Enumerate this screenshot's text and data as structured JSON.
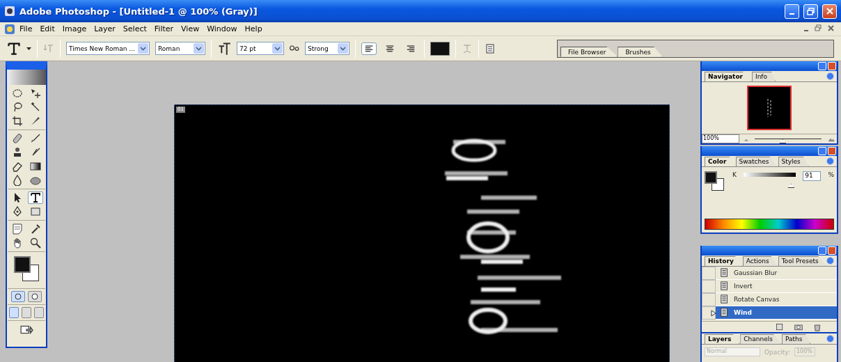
{
  "window": {
    "title": "Adobe Photoshop - [Untitled-1 @ 100% (Gray)]"
  },
  "menu": [
    "File",
    "Edit",
    "Image",
    "Layer",
    "Select",
    "Filter",
    "View",
    "Window",
    "Help"
  ],
  "options_bar": {
    "font_family": "Times New Roman ...",
    "font_style": "Roman",
    "font_size": "72 pt",
    "anti_alias": "Strong",
    "align": [
      {
        "kind": "left",
        "selected": true
      },
      {
        "kind": "center",
        "selected": false
      },
      {
        "kind": "right",
        "selected": false
      }
    ]
  },
  "palette_well": {
    "tabs": [
      {
        "label": "File Browser"
      },
      {
        "label": "Brushes"
      }
    ]
  },
  "toolbox": {
    "groups": [
      [
        {
          "kind": "marquee",
          "selected": false
        },
        {
          "kind": "move",
          "selected": false
        },
        {
          "kind": "lasso",
          "selected": false
        },
        {
          "kind": "wand",
          "selected": false
        },
        {
          "kind": "crop",
          "selected": false
        },
        {
          "kind": "slice",
          "selected": false
        }
      ],
      [
        {
          "kind": "bandage",
          "selected": false
        },
        {
          "kind": "brush",
          "selected": false
        },
        {
          "kind": "stamp",
          "selected": false
        },
        {
          "kind": "art-brush",
          "selected": false
        },
        {
          "kind": "eraser",
          "selected": false
        },
        {
          "kind": "gradient",
          "selected": false
        },
        {
          "kind": "drop",
          "selected": false
        },
        {
          "kind": "sponge",
          "selected": false
        }
      ],
      [
        {
          "kind": "arrow",
          "selected": false
        },
        {
          "kind": "type",
          "selected": true
        },
        {
          "kind": "pen",
          "selected": false
        },
        {
          "kind": "rect",
          "selected": false
        }
      ],
      [
        {
          "kind": "note",
          "selected": false
        },
        {
          "kind": "eyedropper",
          "selected": false
        },
        {
          "kind": "hand",
          "selected": false
        },
        {
          "kind": "zoom",
          "selected": false
        }
      ]
    ],
    "mask_modes": [
      {
        "selected": true
      },
      {
        "selected": false
      }
    ],
    "screen_modes": [
      {
        "selected": true
      },
      {
        "selected": false
      },
      {
        "selected": false
      }
    ]
  },
  "document": {
    "badge": "01"
  },
  "navigator": {
    "tabs": [
      {
        "label": "Navigator",
        "selected": true
      },
      {
        "label": "Info",
        "selected": false
      }
    ],
    "zoom": "100%",
    "zoom_slider": {
      "level": 0.42
    }
  },
  "color": {
    "tabs": [
      {
        "label": "Color",
        "selected": true
      },
      {
        "label": "Swatches",
        "selected": false
      },
      {
        "label": "Styles",
        "selected": false
      }
    ],
    "channel": "K",
    "slider": {
      "level": 0.91
    },
    "value": "91",
    "unit": "%"
  },
  "history": {
    "tabs": [
      {
        "label": "History",
        "selected": true
      },
      {
        "label": "Actions",
        "selected": false
      },
      {
        "label": "Tool Presets",
        "selected": false
      }
    ],
    "items": [
      {
        "label": "Gaussian Blur",
        "selected": false
      },
      {
        "label": "Invert",
        "selected": false
      },
      {
        "label": "Rotate Canvas",
        "selected": false
      },
      {
        "label": "Wind",
        "selected": true
      }
    ]
  },
  "layers": {
    "tabs": [
      {
        "label": "Layers",
        "selected": true
      },
      {
        "label": "Channels",
        "selected": false
      },
      {
        "label": "Paths",
        "selected": false
      }
    ],
    "blend_mode": "Normal",
    "opacity_label": "Opacity:",
    "opacity": "100%",
    "disabled": true
  }
}
